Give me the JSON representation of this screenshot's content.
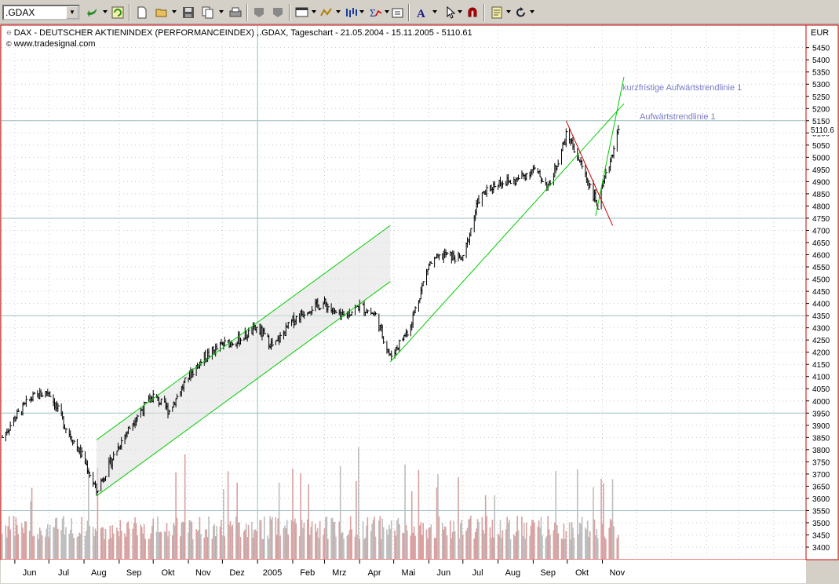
{
  "toolbar": {
    "symbol_value": ".GDAX",
    "buttons": [
      "undo-icon",
      "refresh-icon",
      "new-chart-icon",
      "open-icon",
      "save-icon",
      "copy-icon",
      "print-icon",
      "zoom-out-icon",
      "zoom-in-icon",
      "chart-type-icon",
      "indicator-icon",
      "bar-style-icon",
      "function-icon",
      "properties-icon",
      "text-tool-icon",
      "pointer-icon",
      "magnet-icon",
      "notes-icon",
      "reload-icon"
    ]
  },
  "chart": {
    "title": "DAX  - DEUTSCHER AKTIENINDEX (PERFORMANCEINDEX) ,.GDAX, Tageschart - 21.05.2004 - 15.11.2005 - 5110.61",
    "source": "www.tradesignal.com",
    "currency_label": "EUR",
    "last_price": "5110.6",
    "trend_label_short": "kurzfristige Aufwärtstrendlinie 1",
    "trend_label_long": "Aufwärtstrendlinie 1",
    "colors": {
      "plot_bg": "#ffffff",
      "frame": "#cc0000",
      "bars": "#000000",
      "channel": "#00cc00",
      "down_trend": "#cc0000",
      "volume_up": "#d9a0a0",
      "volume_down": "#bdbdbd",
      "h_lines": "#a0c0c0"
    }
  },
  "chart_data": {
    "type": "line",
    "title": "DAX  - DEUTSCHER AKTIENINDEX (PERFORMANCEINDEX) ,.GDAX, Tageschart - 21.05.2004 - 15.11.2005 - 5110.61",
    "xlabel": "",
    "ylabel": "EUR",
    "ylim": [
      3390,
      5500
    ],
    "y_ticks": [
      5450,
      5400,
      5350,
      5300,
      5250,
      5200,
      5150,
      5100,
      5050,
      5000,
      4950,
      4900,
      4850,
      4800,
      4750,
      4700,
      4650,
      4600,
      4550,
      4500,
      4450,
      4400,
      4350,
      4300,
      4250,
      4200,
      4150,
      4100,
      4050,
      4000,
      3950,
      3900,
      3850,
      3800,
      3750,
      3700,
      3650,
      3600,
      3550,
      3500,
      3450,
      3400
    ],
    "x_ticks": [
      "Jun",
      "Jul",
      "Aug",
      "Sep",
      "Okt",
      "Nov",
      "Dez",
      "2005",
      "Feb",
      "Mrz",
      "Apr",
      "Mai",
      "Jun",
      "Jul",
      "Aug",
      "Sep",
      "Okt",
      "Nov"
    ],
    "horizontal_lines": [
      5150,
      4750,
      4350,
      3950,
      3550
    ],
    "series": [
      {
        "name": "",
        "x": [
          "2004-05-21",
          "2004-06-01",
          "2004-06-15",
          "2004-07-01",
          "2004-07-15",
          "2004-08-01",
          "2004-08-12",
          "2004-09-01",
          "2004-09-15",
          "2004-10-01",
          "2004-10-15",
          "2004-11-01",
          "2004-11-15",
          "2004-12-01",
          "2004-12-15",
          "2005-01-01",
          "2005-01-15",
          "2005-02-01",
          "2005-02-15",
          "2005-03-01",
          "2005-03-15",
          "2005-04-01",
          "2005-04-15",
          "2005-04-28",
          "2005-05-15",
          "2005-06-01",
          "2005-06-15",
          "2005-07-01",
          "2005-07-15",
          "2005-08-01",
          "2005-08-15",
          "2005-09-01",
          "2005-09-15",
          "2005-10-01",
          "2005-10-15",
          "2005-10-28",
          "2005-11-15"
        ],
        "y": [
          3850,
          3930,
          4010,
          4040,
          3900,
          3760,
          3630,
          3820,
          3930,
          4020,
          3960,
          4100,
          4180,
          4230,
          4250,
          4300,
          4220,
          4330,
          4380,
          4400,
          4340,
          4390,
          4350,
          4180,
          4300,
          4560,
          4600,
          4580,
          4830,
          4900,
          4900,
          4950,
          4880,
          5100,
          4950,
          4800,
          5110
        ]
      }
    ],
    "trendlines": [
      {
        "name": "channel-upper",
        "from": [
          "2004-08-12",
          3840
        ],
        "to": [
          "2005-04-28",
          4720
        ]
      },
      {
        "name": "channel-lower",
        "from": [
          "2004-08-12",
          3610
        ],
        "to": [
          "2005-04-28",
          4490
        ]
      },
      {
        "name": "Aufwärtstrendlinie 1",
        "from": [
          "2005-04-28",
          4160
        ],
        "to": [
          "2005-11-20",
          5220
        ]
      },
      {
        "name": "kurzfristige Aufwärtstrendlinie 1",
        "from": [
          "2005-10-26",
          4760
        ],
        "to": [
          "2005-11-20",
          5330
        ]
      },
      {
        "name": "down-trend",
        "from": [
          "2005-09-30",
          5150
        ],
        "to": [
          "2005-11-10",
          4720
        ]
      }
    ],
    "grid": true,
    "legend": "none"
  }
}
